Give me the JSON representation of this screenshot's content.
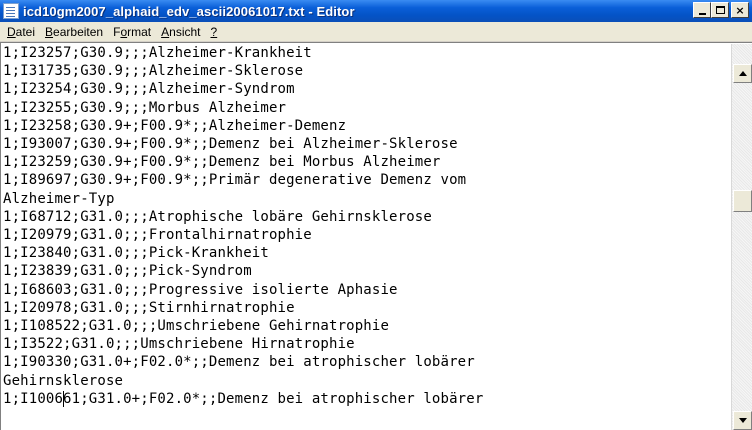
{
  "window": {
    "title": "icd10gm2007_alphaid_edv_ascii20061017.txt - Editor",
    "controls": {
      "minimize": "_",
      "maximize": "□",
      "close": "×"
    }
  },
  "menubar": {
    "items": [
      {
        "accel": "D",
        "rest": "atei"
      },
      {
        "accel": "B",
        "rest": "earbeiten"
      },
      {
        "pre": "F",
        "accel": "o",
        "rest": "rmat"
      },
      {
        "accel": "A",
        "rest": "nsicht"
      },
      {
        "accel": "?",
        "rest": ""
      }
    ]
  },
  "editor": {
    "lines": [
      "1;I23257;G30.9;;;Alzheimer-Krankheit",
      "1;I31735;G30.9;;;Alzheimer-Sklerose",
      "1;I23254;G30.9;;;Alzheimer-Syndrom",
      "1;I23255;G30.9;;;Morbus Alzheimer",
      "1;I23258;G30.9+;F00.9*;;Alzheimer-Demenz",
      "1;I93007;G30.9+;F00.9*;;Demenz bei Alzheimer-Sklerose",
      "1;I23259;G30.9+;F00.9*;;Demenz bei Morbus Alzheimer",
      "1;I89697;G30.9+;F00.9*;;Primär degenerative Demenz vom",
      "Alzheimer-Typ",
      "1;I68712;G31.0;;;Atrophische lobäre Gehirnsklerose",
      "1;I20979;G31.0;;;Frontalhirnatrophie",
      "1;I23840;G31.0;;;Pick-Krankheit",
      "1;I23839;G31.0;;;Pick-Syndrom",
      "1;I68603;G31.0;;;Progressive isolierte Aphasie",
      "1;I20978;G31.0;;;Stirnhirnatrophie",
      "1;I108522;G31.0;;;Umschriebene Gehirnatrophie",
      "1;I3522;G31.0;;;Umschriebene Hirnatrophie",
      "1;I90330;G31.0+;F02.0*;;Demenz bei atrophischer lobärer",
      "Gehirnsklerose",
      "1;I100661;G31.0+;F02.0*;;Demenz bei atrophischer lobärer"
    ],
    "scroll_position": 0.35
  }
}
